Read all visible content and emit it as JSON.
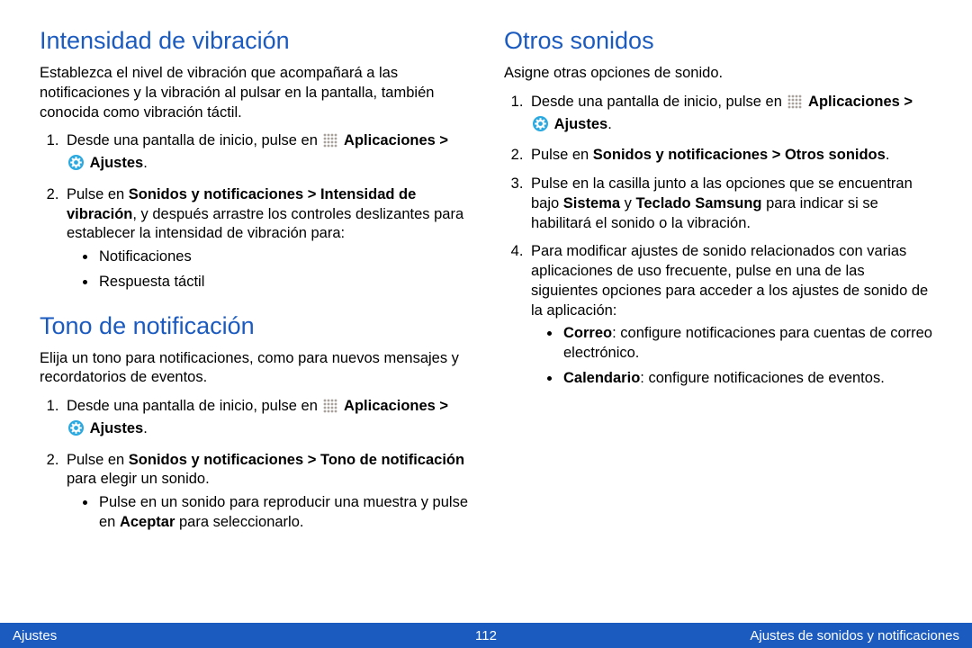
{
  "left": {
    "section1": {
      "heading": "Intensidad de vibración",
      "intro": "Establezca el nivel de vibración que acompañará a las notificaciones y la vibración al pulsar en la pantalla, también conocida como vibración táctil.",
      "step1_a": "Desde una pantalla de inicio, pulse en ",
      "step1_apps": "Aplicaciones > ",
      "step1_settings": " Ajustes",
      "step1_end": ".",
      "step2_a": "Pulse en ",
      "step2_b": "Sonidos y notificaciones > Intensidad de vibración",
      "step2_c": ", y después arrastre los controles deslizantes para establecer la intensidad de vibración para:",
      "bullet1": "Notificaciones",
      "bullet2": "Respuesta táctil"
    },
    "section2": {
      "heading": "Tono de notificación",
      "intro": "Elija un tono para notificaciones, como para nuevos mensajes y recordatorios de eventos.",
      "step1_a": "Desde una pantalla de inicio, pulse en ",
      "step1_apps": "Aplicaciones > ",
      "step1_settings": " Ajustes",
      "step1_end": ".",
      "step2_a": "Pulse en ",
      "step2_b": "Sonidos y notificaciones > Tono de notificación",
      "step2_c": " para elegir un sonido.",
      "sub_a": "Pulse en un sonido para reproducir una muestra y pulse en ",
      "sub_b": "Aceptar",
      "sub_c": " para seleccionarlo."
    }
  },
  "right": {
    "section1": {
      "heading": "Otros sonidos",
      "intro": "Asigne otras opciones de sonido.",
      "step1_a": "Desde una pantalla de inicio, pulse en ",
      "step1_apps": "Aplicaciones > ",
      "step1_settings": " Ajustes",
      "step1_end": ".",
      "step2_a": "Pulse en ",
      "step2_b": "Sonidos y notificaciones > Otros sonidos",
      "step2_c": ".",
      "step3_a": "Pulse en la casilla junto a las opciones que se encuentran bajo ",
      "step3_b": "Sistema",
      "step3_c": " y ",
      "step3_d": "Teclado Samsung",
      "step3_e": " para indicar si se habilitará el sonido o la vibración.",
      "step4": "Para modificar ajustes de sonido relacionados con varias aplicaciones de uso frecuente, pulse en una de las siguientes opciones para acceder a los ajustes de sonido de la aplicación:",
      "b1_a": "Correo",
      "b1_b": ": configure notificaciones para cuentas de correo electrónico.",
      "b2_a": "Calendario",
      "b2_b": ": configure notificaciones de eventos."
    }
  },
  "footer": {
    "left": "Ajustes",
    "center": "112",
    "right": "Ajustes de sonidos y notificaciones"
  }
}
